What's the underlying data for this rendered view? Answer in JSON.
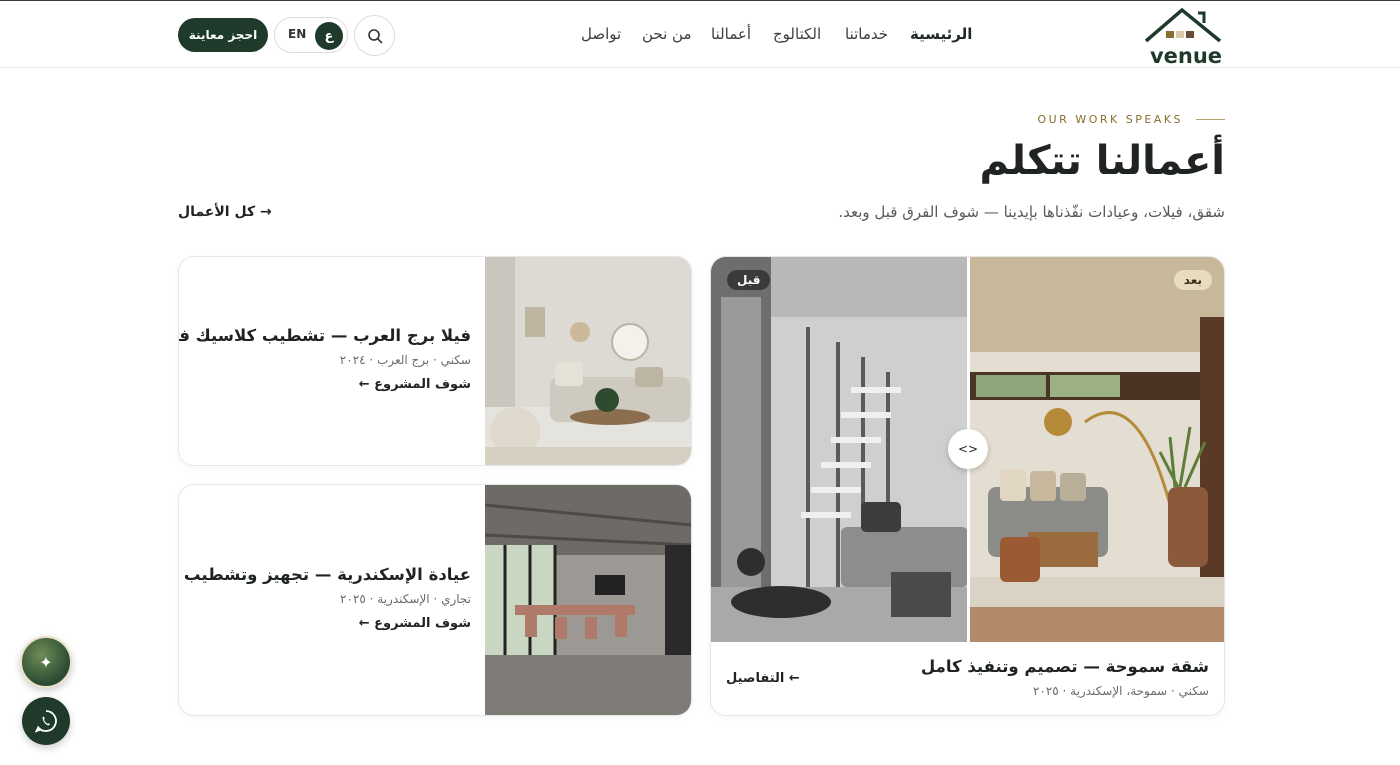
{
  "header": {
    "logo_text": "venue",
    "nav": [
      "الرئيسية",
      "خدماتنا",
      "الكتالوج",
      "أعمالنا",
      "من نحن",
      "تواصل"
    ],
    "lang_en": "EN",
    "lang_ar": "ع",
    "book_label": "احجز معاينة"
  },
  "section": {
    "eyebrow": "OUR WORK SPEAKS",
    "title": "أعمالنا تتكلم",
    "subtitle": "شقق، فيلات، وعيادات نفّذناها بإيدينا — شوف الفرق قبل وبعد.",
    "all_link": "كل الأعمال →"
  },
  "featured": {
    "badge_before": "قبل",
    "badge_after": "بعد",
    "handle": "<>",
    "title": "شقة سموحة — تصميم وتنفيذ كامل",
    "meta": "سكني · سموحة، الإسكندرية · ٢٠٢٥",
    "link": "التفاصيل ←"
  },
  "projects": [
    {
      "title": "فيلا برج العرب — تشطيب كلاسيك فاخر",
      "meta": "سكني · برج العرب · ٢٠٢٤",
      "link": "شوف المشروع ←"
    },
    {
      "title": "عيادة الإسكندرية — تجهيز وتشطيب",
      "meta": "تجاري · الإسكندرية · ٢٠٢٥",
      "link": "شوف المشروع ←"
    }
  ],
  "fab": {
    "spark": "✦"
  },
  "colors": {
    "brand": "#1f3a2a",
    "gold": "#8a6d2e"
  }
}
